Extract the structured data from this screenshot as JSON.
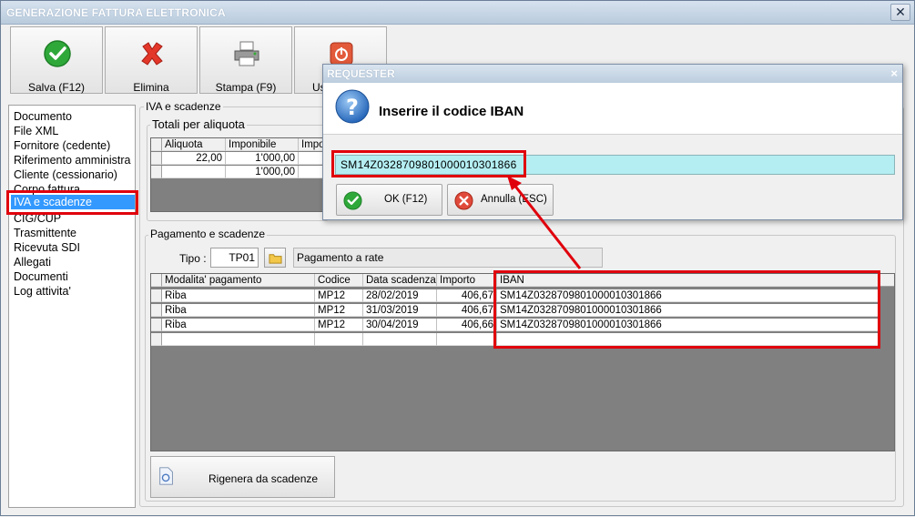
{
  "window": {
    "title": "GENERAZIONE FATTURA ELETTRONICA",
    "close": "✕"
  },
  "toolbar": {
    "save_label": "Salva (F12)",
    "delete_label": "Elimina",
    "print_label": "Stampa (F9)",
    "exit_label": "Us"
  },
  "sidebar": {
    "items": [
      {
        "label": "Documento"
      },
      {
        "label": "File XML"
      },
      {
        "label": "Fornitore (cedente)"
      },
      {
        "label": "Riferimento amministra"
      },
      {
        "label": "Cliente (cessionario)"
      },
      {
        "label": "Corpo fattura"
      },
      {
        "label": "IVA e scadenze"
      },
      {
        "label": "CIG/CUP"
      },
      {
        "label": "Trasmittente"
      },
      {
        "label": "Ricevuta SDI"
      },
      {
        "label": "Allegati"
      },
      {
        "label": "Documenti"
      },
      {
        "label": "Log attivita'"
      }
    ],
    "selected_index": 6
  },
  "iva": {
    "group_title": "IVA e scadenze",
    "totals_title": "Totali per aliquota",
    "columns": [
      "Aliquota",
      "Imponibile",
      "Impos"
    ],
    "rows": [
      [
        "22,00",
        "1'000,00",
        ""
      ],
      [
        "",
        "1'000,00",
        ""
      ]
    ]
  },
  "pagamento": {
    "group_title": "Pagamento e scadenze",
    "tipo_label": "Tipo :",
    "tipo_value": "TP01",
    "tipo_desc": "Pagamento a rate",
    "columns": [
      "Modalita' pagamento",
      "Codice",
      "Data scadenza",
      "Importo",
      "IBAN"
    ],
    "rows": [
      [
        "Riba",
        "MP12",
        "28/02/2019",
        "406,67",
        "SM14Z0328709801000010301866"
      ],
      [
        "Riba",
        "MP12",
        "31/03/2019",
        "406,67",
        "SM14Z0328709801000010301866"
      ],
      [
        "Riba",
        "MP12",
        "30/04/2019",
        "406,66",
        "SM14Z0328709801000010301866"
      ]
    ],
    "regen_label": "Rigenera da scadenze"
  },
  "dialog": {
    "title": "REQUESTER",
    "close": "×",
    "prompt": "Inserire il codice IBAN",
    "input_value": "SM14Z0328709801000010301866",
    "ok_label": "OK (F12)",
    "cancel_label": "Annulla (ESC)"
  },
  "colors": {
    "highlight": "#e0000c",
    "selection": "#3399ff",
    "input_fill": "#b4eef2"
  }
}
